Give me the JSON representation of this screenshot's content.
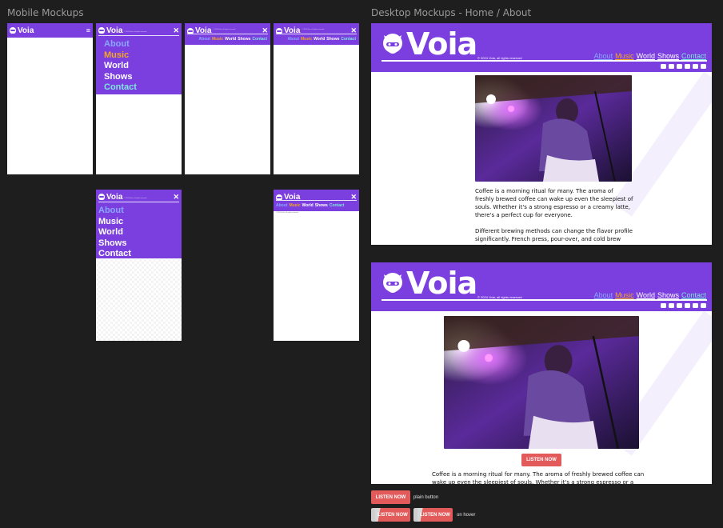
{
  "sections": {
    "mobile": "Mobile Mockups",
    "desktop": "Desktop Mockups - Home / About"
  },
  "brand": {
    "name": "Voia",
    "copyright": "© 2024 Voia, all rights reserved",
    "mini_copy": "© 2024 Voia, all rights reserved"
  },
  "nav": {
    "about": "About",
    "music": "Music",
    "world": "World",
    "shows": "Shows",
    "contact": "Contact"
  },
  "mobile": {
    "hamburger": "≡",
    "close": "✕",
    "tiny_body": "© 2024 Voia, all rights reserved"
  },
  "colors": {
    "purple": "#7b3fe0",
    "about": "#8aa7ff",
    "music": "#f5a623",
    "white": "#ffffff",
    "contact": "#7fe7df",
    "accent_red": "#e25a5a"
  },
  "social_icons": [
    "youtube-icon",
    "discord-icon",
    "instagram-icon",
    "spotify-icon",
    "tiktok-icon",
    "soundcloud-icon"
  ],
  "desktop1": {
    "para1": "Coffee is a morning ritual for many. The aroma of freshly brewed coffee can wake up even the sleepiest of souls. Whether it's a strong espresso or a creamy latte, there's a perfect cup for everyone.",
    "para2": "Different brewing methods can change the flavor profile significantly. French press, pour-over, and cold brew each"
  },
  "desktop2": {
    "listen": "LISTEN NOW",
    "para": "Coffee is a morning ritual for many. The aroma of freshly brewed coffee can wake up even the sleepiest of souls. Whether it's a strong espresso or a creamy"
  },
  "buttons": {
    "listen": "LISTEN NOW",
    "plain_caption": "plain button",
    "hover_caption": "on hover"
  }
}
